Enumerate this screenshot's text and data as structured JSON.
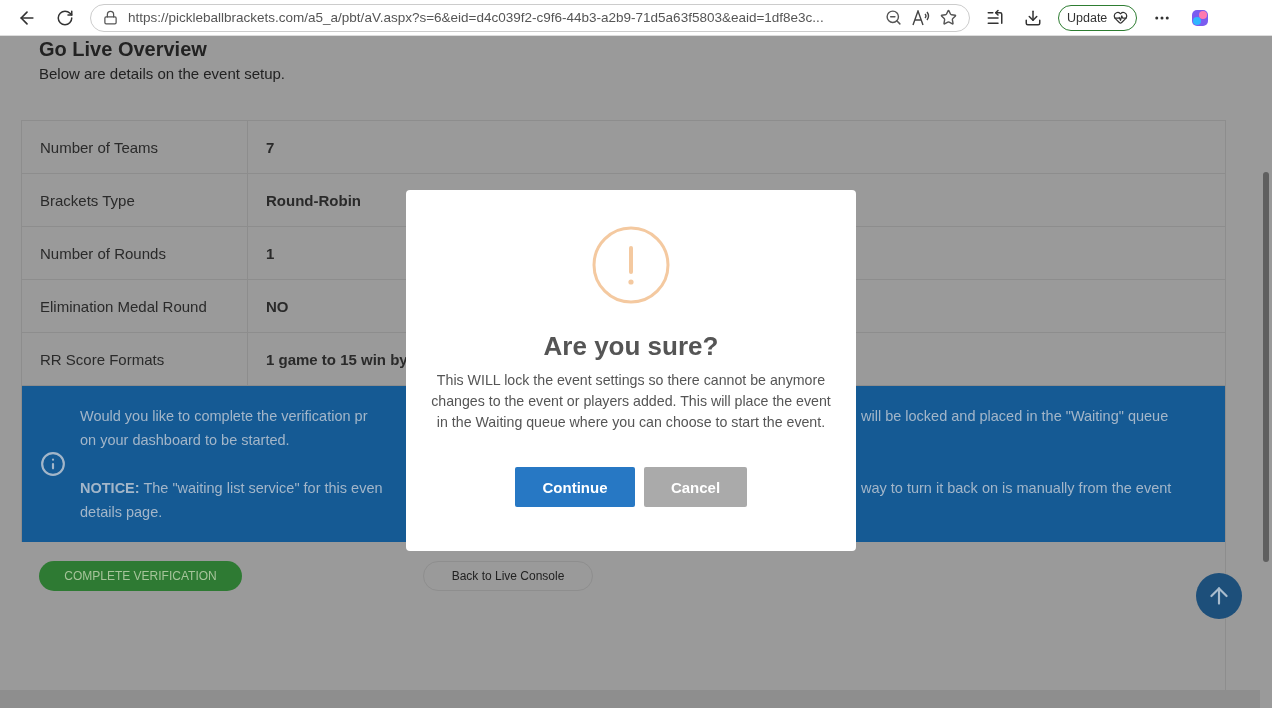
{
  "browser": {
    "url": "https://pickleballbrackets.com/a5_a/pbt/aV.aspx?s=6&eid=d4c039f2-c9f6-44b3-a2b9-71d5a63f5803&eaid=1df8e3c...",
    "update_label": "Update"
  },
  "page": {
    "title": "Go Live Overview",
    "subtitle": "Below are details on the event setup."
  },
  "details": [
    {
      "label": "Number of Teams",
      "value": "7"
    },
    {
      "label": "Brackets Type",
      "value": "Round-Robin"
    },
    {
      "label": "Number of Rounds",
      "value": "1"
    },
    {
      "label": "Elimination Medal Round",
      "value": "NO"
    },
    {
      "label": "RR Score Formats",
      "value": "1 game to 15 win by"
    }
  ],
  "info": {
    "lines": [
      {
        "left": "Would you like to complete the verification pr",
        "right": "will be locked and placed in the \"Waiting\" queue"
      },
      {
        "left": "on your dashboard to be started."
      }
    ],
    "notice_lines": [
      {
        "left": "**NOTICE:** The \"waiting list service\" for this even",
        "right": "way to turn it back on is manually from the event"
      },
      {
        "left": "details page."
      }
    ]
  },
  "buttons": {
    "complete": "COMPLETE VERIFICATION",
    "back": "Back to Live Console"
  },
  "dialog": {
    "title": "Are you sure?",
    "message": "This WILL lock the event settings so there cannot be anymore changes to the event or players added. This will place the event in the Waiting queue where you can choose to start the event.",
    "confirm": "Continue",
    "cancel": "Cancel"
  }
}
